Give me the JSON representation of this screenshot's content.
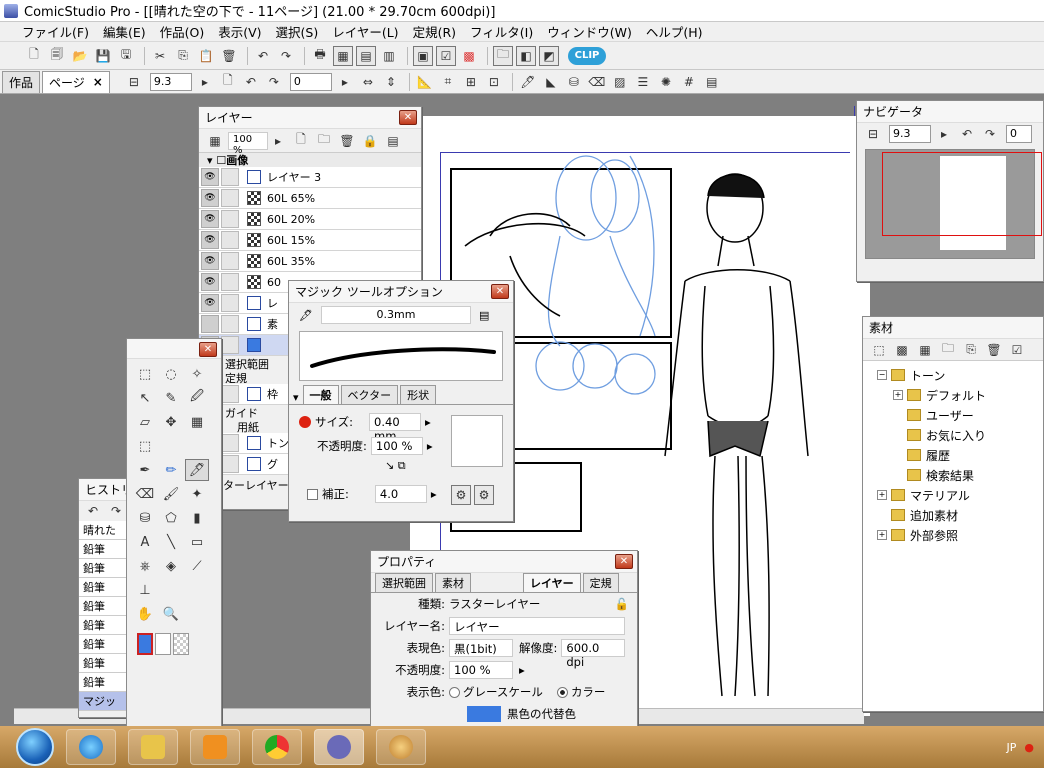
{
  "window": {
    "title": "ComicStudio Pro - [[晴れた空の下で - 11ページ] (21.00 * 29.70cm 600dpi)]"
  },
  "menu": [
    "ファイル(F)",
    "編集(E)",
    "作品(O)",
    "表示(V)",
    "選択(S)",
    "レイヤー(L)",
    "定規(R)",
    "フィルタ(I)",
    "ウィンドウ(W)",
    "ヘルプ(H)"
  ],
  "doc_tabs": {
    "work": "作品",
    "page": "ページ",
    "close": "×"
  },
  "toolbar2": {
    "zoom": "9.3",
    "rotation": "0"
  },
  "layer_panel": {
    "title": "レイヤー",
    "opacity": "100 %",
    "group": "画像",
    "layers": [
      "レイヤー 3",
      "60L 65%",
      "60L 20%",
      "60L 15%",
      "60L 35%",
      "60",
      "レ",
      "素"
    ],
    "sections": {
      "selection": "選択範囲",
      "ruler": "定規",
      "guide": "ガイド",
      "paper": "用紙"
    },
    "tail_layers": [
      "枠",
      "トン",
      "グ"
    ],
    "footer": "ターレイヤー"
  },
  "magic_tool_options": {
    "title": "マジック ツールオプション",
    "brush_size": "0.3mm",
    "tabs": [
      "一般",
      "ベクター",
      "形状"
    ],
    "size_label": "サイズ:",
    "size_value": "0.40 mm",
    "opacity_label": "不透明度:",
    "opacity_value": "100 %",
    "correction_label": "補正:",
    "correction_value": "4.0"
  },
  "history_panel": {
    "title": "ヒストリ",
    "items": [
      "晴れた",
      "鉛筆",
      "鉛筆",
      "鉛筆",
      "鉛筆",
      "鉛筆",
      "鉛筆",
      "鉛筆",
      "鉛筆",
      "マジッ"
    ]
  },
  "navigator": {
    "title": "ナビゲータ",
    "zoom": "9.3",
    "rotation": "0"
  },
  "materials": {
    "title": "素材",
    "tree": [
      {
        "label": "トーン",
        "indent": 0,
        "expand": "−"
      },
      {
        "label": "デフォルト",
        "indent": 1,
        "expand": "+"
      },
      {
        "label": "ユーザー",
        "indent": 1,
        "expand": ""
      },
      {
        "label": "お気に入り",
        "indent": 1,
        "expand": ""
      },
      {
        "label": "履歴",
        "indent": 1,
        "expand": ""
      },
      {
        "label": "検索結果",
        "indent": 1,
        "expand": ""
      },
      {
        "label": "マテリアル",
        "indent": 0,
        "expand": "+"
      },
      {
        "label": "追加素材",
        "indent": 0,
        "expand": ""
      },
      {
        "label": "外部参照",
        "indent": 0,
        "expand": "+"
      }
    ]
  },
  "properties": {
    "title": "プロパティ",
    "tabs": [
      "選択範囲",
      "素材",
      "レイヤー",
      "定規"
    ],
    "type_label": "種類:",
    "type_value": "ラスターレイヤー",
    "name_label": "レイヤー名:",
    "name_value": "レイヤー",
    "color_label": "表現色:",
    "color_value": "黒(1bit)",
    "resolution_label": "解像度:",
    "resolution_value": "600.0 dpi",
    "opacity_label": "不透明度:",
    "opacity_value": "100 %",
    "display_label": "表示色:",
    "grayscale": "グレースケール",
    "color": "カラー",
    "alt_color": "黒色の代替色"
  },
  "tray": {
    "lang": "JP"
  },
  "colors": {
    "accent_blue": "#3a7ae0",
    "sketch_blue": "#6f9ee0",
    "titlebar": "#ffffff"
  }
}
